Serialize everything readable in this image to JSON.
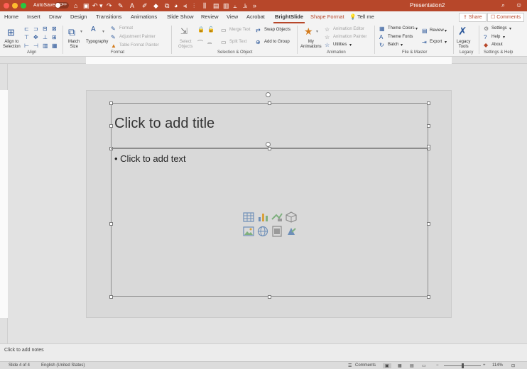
{
  "titlebar": {
    "autosave_label": "AutoSave",
    "autosave_state": "OFF",
    "document_title": "Presentation2"
  },
  "tabs": [
    "Home",
    "Insert",
    "Draw",
    "Design",
    "Transitions",
    "Animations",
    "Slide Show",
    "Review",
    "View",
    "Acrobat",
    "BrightSlide",
    "Shape Format"
  ],
  "tell_me": "Tell me",
  "share_label": "Share",
  "comments_label": "Comments",
  "ribbon": {
    "align": {
      "align_to_selection": "Align to\nSelection",
      "group_label": "Align"
    },
    "format": {
      "match_size": "Match\nSize",
      "typography": "Typography",
      "format": "Format",
      "adjustment_painter": "Adjustment Painter",
      "table_format_painter": "Table Format Painter",
      "group_label": "Format"
    },
    "selection": {
      "select_objects": "Select\nObjects",
      "merge_text": "Merge Text",
      "split_text": "Split Text",
      "swap_objects": "Swap Objects",
      "add_to_group": "Add to Group",
      "group_label": "Selection & Object"
    },
    "animation": {
      "my_animations": "My\nAnimations",
      "animation_editor": "Animation Editor",
      "animation_painter": "Animation Painter",
      "utilities": "Utilities",
      "group_label": "Animation"
    },
    "file_master": {
      "theme_colors": "Theme Colors",
      "theme_fonts": "Theme Fonts",
      "batch": "Batch",
      "review": "Review",
      "export": "Export",
      "group_label": "File & Master"
    },
    "legacy": {
      "legacy_tools": "Legacy\nTools",
      "group_label": "Legacy"
    },
    "settings_help": {
      "settings": "Settings",
      "help": "Help",
      "about": "About",
      "group_label": "Settings & Help"
    }
  },
  "slide": {
    "title_placeholder": "Click to add title",
    "body_placeholder": "Click to add text"
  },
  "notes_placeholder": "Click to add notes",
  "status": {
    "slide_indicator": "Slide 4 of 4",
    "language": "English (United States)",
    "comments": "Comments",
    "zoom": "114%"
  },
  "colors": {
    "accent": "#b7472a",
    "ribbon_bg": "#f3f3f3",
    "slide_bg": "#d9d9d9"
  }
}
